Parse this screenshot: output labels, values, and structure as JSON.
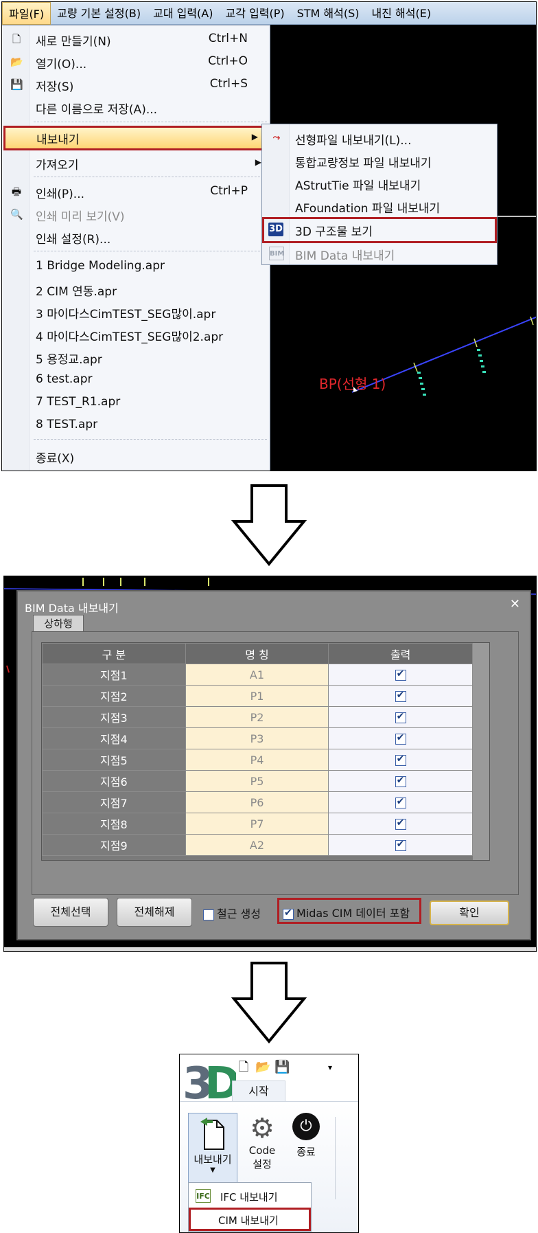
{
  "panel1": {
    "menubar": [
      "파일(F)",
      "교량 기본 설정(B)",
      "교대 입력(A)",
      "교각 입력(P)",
      "STM 해석(S)",
      "내진 해석(E)"
    ],
    "file_menu": {
      "new": {
        "label": "새로 만들기(N)",
        "shortcut": "Ctrl+N"
      },
      "open": {
        "label": "열기(O)...",
        "shortcut": "Ctrl+O"
      },
      "save": {
        "label": "저장(S)",
        "shortcut": "Ctrl+S"
      },
      "save_as": {
        "label": "다른 이름으로 저장(A)..."
      },
      "export": {
        "label": "내보내기"
      },
      "import": {
        "label": "가져오기"
      },
      "print": {
        "label": "인쇄(P)...",
        "shortcut": "Ctrl+P"
      },
      "print_preview": {
        "label": "인쇄 미리 보기(V)"
      },
      "print_setup": {
        "label": "인쇄 설정(R)..."
      },
      "recent": [
        "1 Bridge Modeling.apr",
        "2 CIM 연동.apr",
        "3 마이다스CimTEST_SEG많이.apr",
        "4 마이다스CimTEST_SEG많이2.apr",
        "5 용정교.apr",
        "6 test.apr",
        "7 TEST_R1.apr",
        "8 TEST.apr"
      ],
      "exit": {
        "label": "종료(X)"
      }
    },
    "export_submenu": [
      "선형파일 내보내기(L)...",
      "통합교량정보 파일 내보내기",
      "AStrutTie 파일 내보내기",
      "AFoundation 파일 내보내기",
      "3D 구조물 보기",
      "BIM Data 내보내기"
    ],
    "bp_label": "BP(선형 1)"
  },
  "panel2": {
    "title": "BIM Data 내보내기",
    "tab": "상하행",
    "headers": [
      "구 분",
      "명 칭",
      "출력"
    ],
    "rows": [
      {
        "point": "지점1",
        "name": "A1",
        "output": true
      },
      {
        "point": "지점2",
        "name": "P1",
        "output": true
      },
      {
        "point": "지점3",
        "name": "P2",
        "output": true
      },
      {
        "point": "지점4",
        "name": "P3",
        "output": true
      },
      {
        "point": "지점5",
        "name": "P4",
        "output": true
      },
      {
        "point": "지점6",
        "name": "P5",
        "output": true
      },
      {
        "point": "지점7",
        "name": "P6",
        "output": true
      },
      {
        "point": "지점8",
        "name": "P7",
        "output": true
      },
      {
        "point": "지점9",
        "name": "A2",
        "output": true
      }
    ],
    "select_all": "전체선택",
    "deselect_all": "전체해제",
    "rebar_generate": "철근 생성",
    "include_midas_cim": "Midas CIM 데이터 포함",
    "ok": "확인"
  },
  "panel3": {
    "tab_start": "시작",
    "export_button": "내보내기",
    "code_label": "Code",
    "settings_label": "설정",
    "exit_label": "종료",
    "ifc_export": "IFC 내보내기",
    "cim_export": "CIM 내보내기",
    "ifc_icon_text": "IFC"
  },
  "colors": {
    "highlight_red": "#b01e23",
    "menu_highlight": "#ffd574",
    "cad_background": "#000000"
  }
}
